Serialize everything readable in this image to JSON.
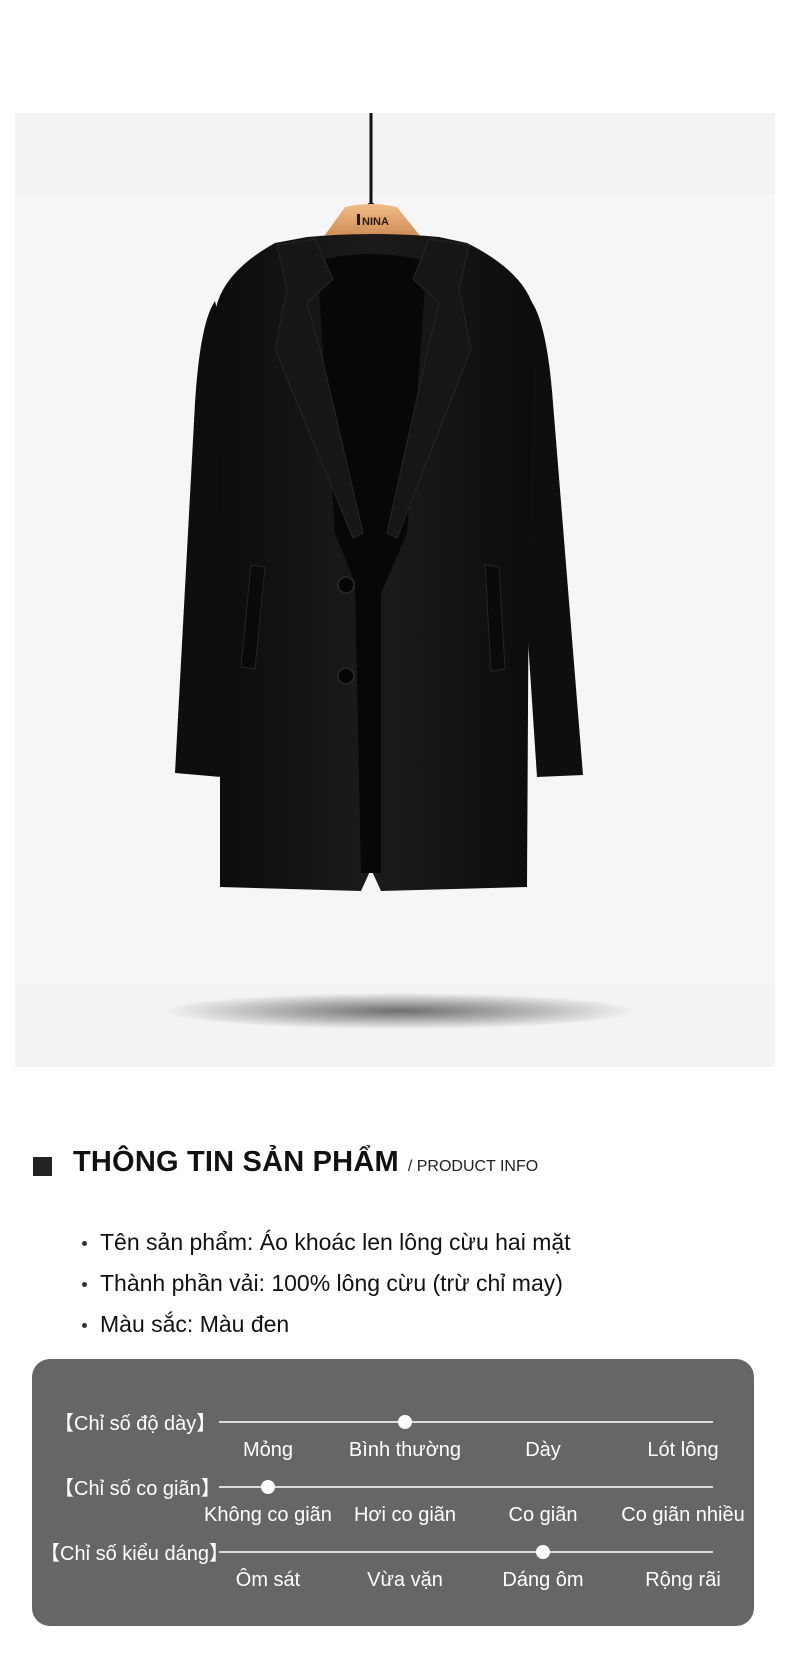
{
  "brand_tag": "NINA",
  "product_info": {
    "title": "THÔNG TIN SẢN PHẨM",
    "subtitle": "/ PRODUCT INFO",
    "specs": [
      "Tên sản phẩm: Áo khoác len lông cừu hai mặt",
      "Thành phần vải: 100% lông cừu (trừ chỉ may)",
      "Màu sắc: Màu đen"
    ]
  },
  "indicators": [
    {
      "label": "【Chỉ số độ dày】",
      "options": [
        "Mỏng",
        "Bình thường",
        "Dày",
        "Lót lông"
      ],
      "selected_index": 1
    },
    {
      "label": "【Chỉ số co giãn】",
      "options": [
        "Không co giãn",
        "Hơi co giãn",
        "Co giãn",
        "Co giãn nhiều"
      ],
      "selected_index": 0
    },
    {
      "label": "【Chỉ số kiểu dáng】",
      "options": [
        "Ôm sát",
        "Vừa vặn",
        "Dáng ôm",
        "Rộng rãi"
      ],
      "selected_index": 2
    }
  ],
  "colors": {
    "panel": "#666666",
    "coat": "#141414",
    "hanger": "#e2a36c"
  }
}
